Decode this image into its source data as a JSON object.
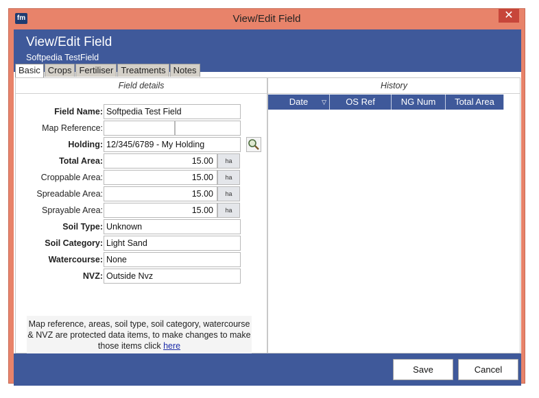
{
  "window": {
    "title": "View/Edit Field",
    "app_icon": "fm",
    "close_glyph": "✕"
  },
  "header": {
    "title": "View/Edit Field",
    "subtitle": "Softpedia TestField"
  },
  "tabs": [
    {
      "label": "Basic",
      "active": true
    },
    {
      "label": "Crops",
      "active": false
    },
    {
      "label": "Fertiliser",
      "active": false
    },
    {
      "label": "Treatments",
      "active": false
    },
    {
      "label": "Notes",
      "active": false
    }
  ],
  "field_details": {
    "heading": "Field details",
    "field_name": {
      "label": "Field Name:",
      "value": "Softpedia Test Field"
    },
    "map_reference": {
      "label": "Map Reference:",
      "value1": "",
      "value2": ""
    },
    "holding": {
      "label": "Holding:",
      "value": "12/345/6789 - My Holding"
    },
    "total_area": {
      "label": "Total Area:",
      "value": "15.00",
      "unit": "ha"
    },
    "croppable_area": {
      "label": "Croppable Area:",
      "value": "15.00",
      "unit": "ha"
    },
    "spreadable_area": {
      "label": "Spreadable Area:",
      "value": "15.00",
      "unit": "ha"
    },
    "sprayable_area": {
      "label": "Sprayable Area:",
      "value": "15.00",
      "unit": "ha"
    },
    "soil_type": {
      "label": "Soil Type:",
      "value": "Unknown"
    },
    "soil_category": {
      "label": "Soil Category:",
      "value": "Light Sand"
    },
    "watercourse": {
      "label": "Watercourse:",
      "value": "None"
    },
    "nvz": {
      "label": "NVZ:",
      "value": "Outside Nvz"
    },
    "note_text": "Map reference, areas, soil type, soil category, watercourse & NVZ are protected data items, to make changes to make those items click",
    "note_link": "here"
  },
  "history": {
    "heading": "History",
    "columns": [
      "Date",
      "OS Ref",
      "NG Num",
      "Total Area"
    ],
    "sort_glyph": "▽",
    "rows": []
  },
  "footer": {
    "save_label": "Save",
    "cancel_label": "Cancel"
  },
  "colors": {
    "accent": "#3f599a",
    "frame": "#e8836a"
  }
}
